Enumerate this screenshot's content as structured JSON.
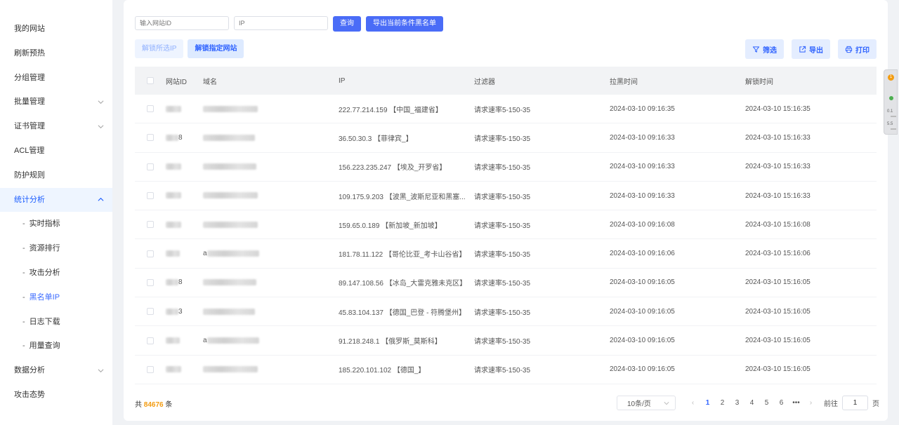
{
  "sidebar": {
    "items": [
      {
        "label": "我的网站"
      },
      {
        "label": "刷新预热"
      },
      {
        "label": "分组管理"
      },
      {
        "label": "批量管理"
      },
      {
        "label": "证书管理"
      },
      {
        "label": "ACL管理"
      },
      {
        "label": "防护规则"
      },
      {
        "label": "统计分析"
      },
      {
        "label": "实时指标"
      },
      {
        "label": "资源排行"
      },
      {
        "label": "攻击分析"
      },
      {
        "label": "黑名单IP"
      },
      {
        "label": "日志下载"
      },
      {
        "label": "用量查询"
      },
      {
        "label": "数据分析"
      },
      {
        "label": "攻击态势"
      }
    ]
  },
  "filters": {
    "site_id_placeholder": "输入网站ID",
    "ip_placeholder": "IP",
    "query_label": "查询",
    "export_blacklist_label": "导出当前条件黑名单"
  },
  "actions": {
    "unlock_selected_label": "解锁所选IP",
    "unlock_site_label": "解锁指定网站",
    "filter_label": "筛选",
    "export_label": "导出",
    "print_label": "打印"
  },
  "table": {
    "headers": {
      "site_id": "网站ID",
      "domain": "域名",
      "ip": "IP",
      "filter": "过滤器",
      "block_time": "拉黑时间",
      "unblock_time": "解锁时间"
    },
    "rows": [
      {
        "site_id": "",
        "domain": "",
        "ip": "222.77.214.159 【中国_福建省】",
        "filter": "请求速率5-150-35",
        "block_time": "2024-03-10 09:16:35",
        "unblock_time": "2024-03-10 15:16:35"
      },
      {
        "site_id": "8",
        "domain": "",
        "ip": "36.50.30.3 【菲律宾_】",
        "filter": "请求速率5-150-35",
        "block_time": "2024-03-10 09:16:33",
        "unblock_time": "2024-03-10 15:16:33"
      },
      {
        "site_id": "",
        "domain": "",
        "ip": "156.223.235.247 【埃及_开罗省】",
        "filter": "请求速率5-150-35",
        "block_time": "2024-03-10 09:16:33",
        "unblock_time": "2024-03-10 15:16:33"
      },
      {
        "site_id": "",
        "domain": "",
        "ip": "109.175.9.203 【波黑_波斯尼亚和黑塞...",
        "filter": "请求速率5-150-35",
        "block_time": "2024-03-10 09:16:33",
        "unblock_time": "2024-03-10 15:16:33"
      },
      {
        "site_id": "",
        "domain": "",
        "ip": "159.65.0.189 【新加坡_新加坡】",
        "filter": "请求速率5-150-35",
        "block_time": "2024-03-10 09:16:08",
        "unblock_time": "2024-03-10 15:16:08"
      },
      {
        "site_id": "",
        "domain": "a",
        "ip": "181.78.11.122 【哥伦比亚_考卡山谷省】",
        "filter": "请求速率5-150-35",
        "block_time": "2024-03-10 09:16:06",
        "unblock_time": "2024-03-10 15:16:06"
      },
      {
        "site_id": "8",
        "domain": "",
        "ip": "89.147.108.56 【冰岛_大雷克雅未克区】",
        "filter": "请求速率5-150-35",
        "block_time": "2024-03-10 09:16:05",
        "unblock_time": "2024-03-10 15:16:05"
      },
      {
        "site_id": "3",
        "domain": "",
        "ip": "45.83.104.137 【德国_巴登 - 符腾堡州】",
        "filter": "请求速率5-150-35",
        "block_time": "2024-03-10 09:16:05",
        "unblock_time": "2024-03-10 15:16:05"
      },
      {
        "site_id": "",
        "domain": "a",
        "ip": "91.218.248.1 【俄罗斯_莫斯科】",
        "filter": "请求速率5-150-35",
        "block_time": "2024-03-10 09:16:05",
        "unblock_time": "2024-03-10 15:16:05"
      },
      {
        "site_id": "",
        "domain": "",
        "ip": "185.220.101.102 【德国_】",
        "filter": "请求速率5-150-35",
        "block_time": "2024-03-10 09:16:05",
        "unblock_time": "2024-03-10 15:16:05"
      }
    ]
  },
  "footer": {
    "total_prefix": "共",
    "total_count": "84676",
    "total_suffix": "条",
    "page_size": "10条/页",
    "pages": [
      "1",
      "2",
      "3",
      "4",
      "5",
      "6"
    ],
    "ellipsis": "•••",
    "current_page": "1",
    "goto_label": "前往",
    "goto_value": "1",
    "page_suffix": "页"
  },
  "float_widget": {
    "badge": "1",
    "stat1": "0.1",
    "stat2": "5.5"
  },
  "colors": {
    "primary": "#4a6cf7",
    "active_text": "#2f63ff",
    "count_highlight": "#f39c12"
  }
}
